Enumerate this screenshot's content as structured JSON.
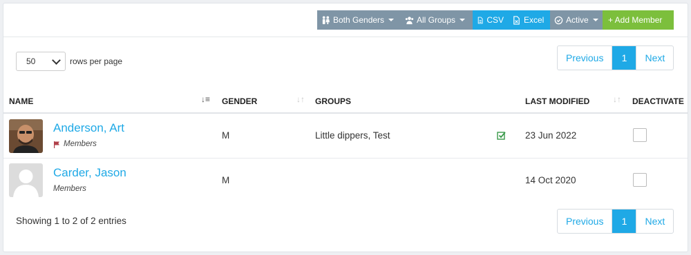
{
  "toolbar": {
    "genders_label": "Both Genders",
    "groups_label": "All Groups",
    "csv_label": "CSV",
    "excel_label": "Excel",
    "active_label": "Active",
    "add_member_label": "+ Add Member"
  },
  "length_control": {
    "selected": "50",
    "label": "rows per page"
  },
  "pagination": {
    "previous": "Previous",
    "current": "1",
    "next": "Next"
  },
  "table": {
    "columns": [
      "NAME",
      "GENDER",
      "GROUPS",
      "LAST MODIFIED",
      "DEACTIVATE"
    ],
    "rows": [
      {
        "name": "Anderson, Art",
        "role": "Members",
        "gender": "M",
        "groups": "Little dippers, Test",
        "last_modified": "23 Jun 2022",
        "avatar": "photo",
        "flag_icon": "flag-icon",
        "groups_checked": true,
        "deactivate": false
      },
      {
        "name": "Carder, Jason",
        "role": "Members",
        "gender": "M",
        "groups": "",
        "last_modified": "14 Oct 2020",
        "avatar": "placeholder",
        "deactivate": false
      }
    ]
  },
  "footer": {
    "info": "Showing 1 to 2 of 2 entries"
  },
  "colors": {
    "accent_blue": "#1fa9e6",
    "toolbar_gray": "#7f95a6",
    "add_green": "#7cbf3c"
  }
}
